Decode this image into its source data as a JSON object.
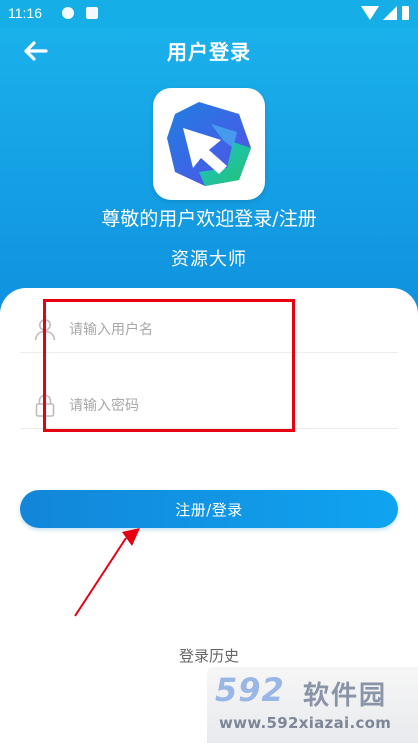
{
  "status_bar": {
    "time": "11:16",
    "icons": [
      "shield-icon",
      "app-icon",
      "wifi-icon",
      "signal-icon",
      "battery-icon"
    ]
  },
  "header": {
    "title": "用户登录",
    "welcome": "尊敬的用户欢迎登录/注册",
    "brand": "资源大师",
    "background_color": "#1ab1eb"
  },
  "form": {
    "username_placeholder": "请输入用户名",
    "password_placeholder": "请输入密码",
    "submit_label": "注册/登录",
    "history_label": "登录历史"
  },
  "colors": {
    "accent": "#1286d9",
    "highlight": "#e60012"
  },
  "watermark": {
    "logo": "592软件园",
    "url": "www.592xiazai.com"
  }
}
